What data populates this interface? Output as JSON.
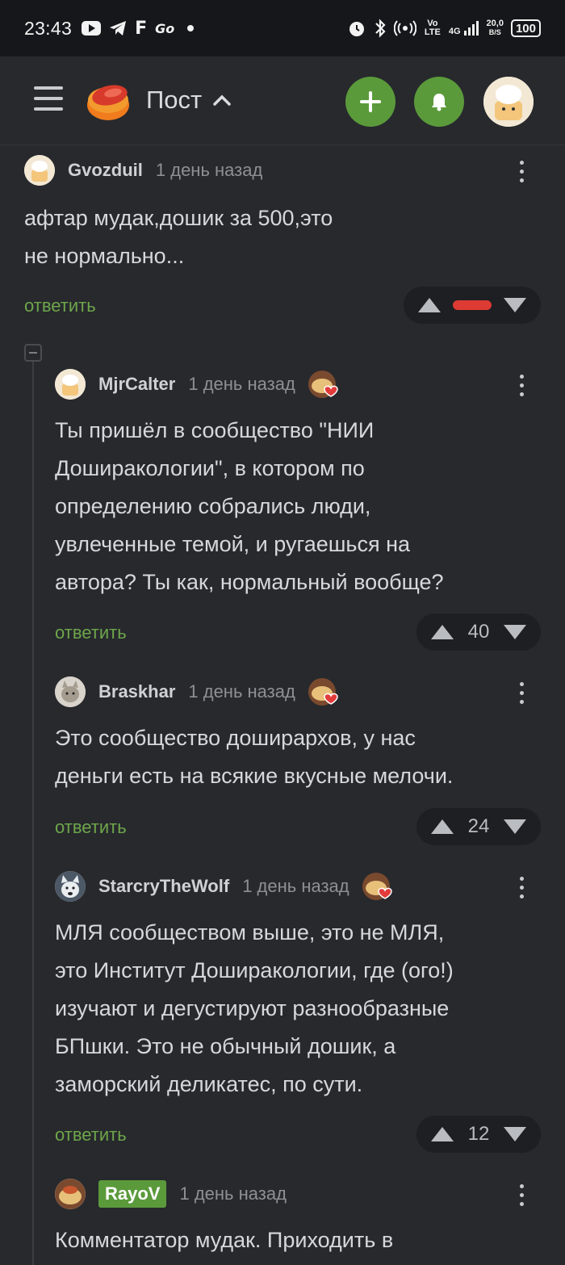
{
  "status_bar": {
    "time": "23:43",
    "left_icons": [
      "youtube-icon",
      "telegram-icon",
      "facebook-icon",
      "go-icon",
      "dot-icon"
    ],
    "right_icons": [
      "alarm-icon",
      "bluetooth-icon",
      "hotspot-icon",
      "volte-icon",
      "signal-icon"
    ],
    "volte": "Vo LTE",
    "net": "4G",
    "speed": "20,0",
    "speed_unit": "B/S",
    "battery": "100"
  },
  "header": {
    "title": "Пост",
    "icons": [
      "menu-icon",
      "pikabu-logo",
      "chevron-up-icon",
      "plus-icon",
      "bell-icon",
      "avatar"
    ]
  },
  "colors": {
    "accent_green": "#5b9a3b",
    "reply_green": "#6ea64a",
    "downvote_red": "#dd3b34"
  },
  "comments": [
    {
      "user": "Gvozduil",
      "time": "1 день назад",
      "text": "афтар мудак,дошик за 500,это\nне нормально...",
      "reply": "ответить",
      "rating": "",
      "award": false
    },
    {
      "user": "MjrCalter",
      "time": "1 день назад",
      "text": "Ты пришёл в сообщество \"НИИ\nДоширакологии\", в котором по\nопределению собрались люди,\nувлеченные темой, и ругаешься на\nавтора? Ты как, нормальный вообще?",
      "reply": "ответить",
      "rating": "40",
      "award": true
    },
    {
      "user": "Braskhar",
      "time": "1 день назад",
      "text": "Это сообщество доширархов, у нас\nденьги есть на всякие вкусные мелочи.",
      "reply": "ответить",
      "rating": "24",
      "award": true
    },
    {
      "user": "StarcryTheWolf",
      "time": "1 день назад",
      "text": "МЛЯ сообществом выше, это не МЛЯ,\nэто Институт Доширакологии, где (ого!)\nизучают и дегустируют разнообразные\nБПшки. Это не обычный дошик, а\nзаморский деликатес, по сути.",
      "reply": "ответить",
      "rating": "12",
      "award": true
    },
    {
      "user": "RayoV",
      "time": "1 день назад",
      "text": "Комментатор мудак. Приходить в",
      "reply": "",
      "rating": "",
      "award": false
    }
  ]
}
